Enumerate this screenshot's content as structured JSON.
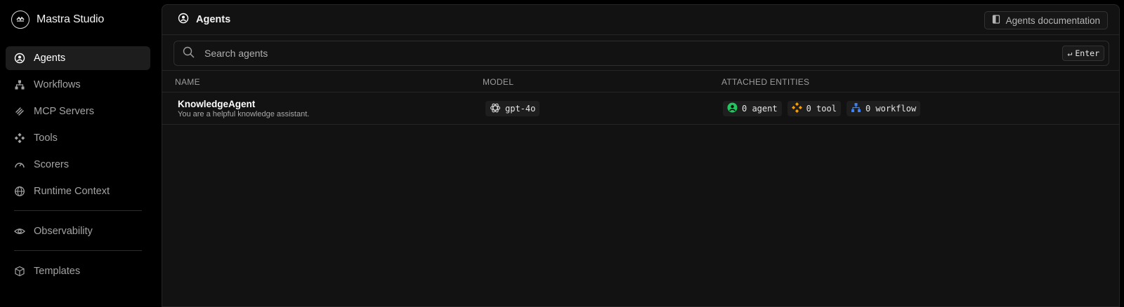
{
  "app": {
    "title": "Mastra Studio"
  },
  "sidebar": {
    "items": [
      {
        "label": "Agents",
        "icon": "agent-circle-icon",
        "active": true
      },
      {
        "label": "Workflows",
        "icon": "workflow-icon"
      },
      {
        "label": "MCP Servers",
        "icon": "mcp-icon"
      },
      {
        "label": "Tools",
        "icon": "tools-icon"
      },
      {
        "label": "Scorers",
        "icon": "gauge-icon"
      },
      {
        "label": "Runtime Context",
        "icon": "globe-icon"
      }
    ],
    "secondary": [
      {
        "label": "Observability",
        "icon": "eye-icon"
      }
    ],
    "tertiary": [
      {
        "label": "Templates",
        "icon": "box-icon"
      }
    ]
  },
  "header": {
    "title": "Agents",
    "doc_button": "Agents documentation"
  },
  "search": {
    "placeholder": "Search agents",
    "enter_hint": "Enter"
  },
  "table": {
    "columns": [
      "NAME",
      "MODEL",
      "ATTACHED ENTITIES"
    ],
    "rows": [
      {
        "name": "KnowledgeAgent",
        "description": "You are a helpful knowledge assistant.",
        "model": "gpt-4o",
        "entities": {
          "agent": "0 agent",
          "tool": "0 tool",
          "workflow": "0 workflow"
        }
      }
    ]
  },
  "colors": {
    "agent_icon": "#22c55e",
    "tool_icon": "#f59e0b",
    "workflow_icon": "#3b82f6"
  }
}
